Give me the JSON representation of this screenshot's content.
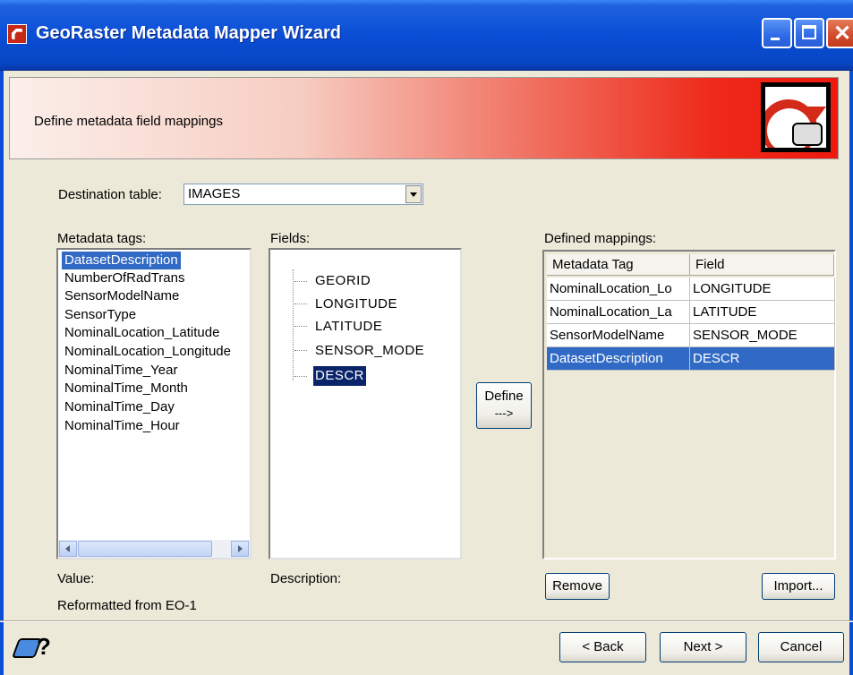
{
  "window": {
    "title": "GeoRaster Metadata Mapper Wizard"
  },
  "banner": {
    "text": "Define metadata field mappings"
  },
  "destination": {
    "label": "Destination table:",
    "value": "IMAGES"
  },
  "metadata_tags": {
    "label": "Metadata tags:",
    "items": [
      "DatasetDescription",
      "NumberOfRadTrans",
      "SensorModelName",
      "SensorType",
      "NominalLocation_Latitude",
      "NominalLocation_Longitude",
      "NominalTime_Year",
      "NominalTime_Month",
      "NominalTime_Day",
      "NominalTime_Hour"
    ],
    "selected": "DatasetDescription"
  },
  "fields": {
    "label": "Fields:",
    "items": [
      "GEORID",
      "LONGITUDE",
      "LATITUDE",
      "SENSOR_MODE",
      "DESCR"
    ],
    "selected": "DESCR"
  },
  "define_button": {
    "line1": "Define",
    "line2": "--->"
  },
  "mappings": {
    "label": "Defined mappings:",
    "headers": [
      "Metadata Tag",
      "Field"
    ],
    "rows": [
      [
        "NominalLocation_Lo",
        "LONGITUDE"
      ],
      [
        "NominalLocation_La",
        "LATITUDE"
      ],
      [
        "SensorModelName",
        "SENSOR_MODE"
      ],
      [
        "DatasetDescription",
        "DESCR"
      ]
    ],
    "selected_row": "DatasetDescription"
  },
  "value": {
    "label": "Value:",
    "text": "Reformatted from EO-1"
  },
  "description": {
    "label": "Description:"
  },
  "buttons": {
    "remove": "Remove",
    "import": "Import...",
    "back": "< Back",
    "next": "Next >",
    "cancel": "Cancel",
    "help": "?"
  },
  "colors": {
    "selection": "#316ac5",
    "titlebar": "#0a4ed6",
    "banner_red": "#ee1a0e"
  }
}
